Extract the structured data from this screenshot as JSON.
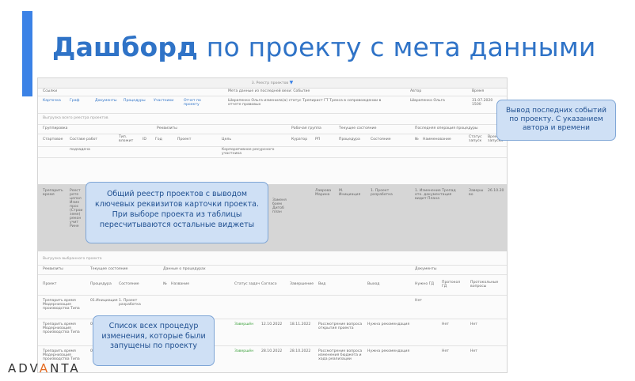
{
  "slide": {
    "title_bold": "Дашборд",
    "title_rest": " по проекту с мета данными"
  },
  "screen": {
    "header": "3. Реестр проектов",
    "row1": {
      "labels": [
        "Ссылки",
        "Мета данные из последней вехи: Событие",
        "Автор",
        "Время"
      ],
      "links": [
        "Карточка",
        "Граф",
        "Документы",
        "Процедуры",
        "Участники",
        "Отчет по проекту"
      ],
      "event": "Шарапенко Ольга изменила(а) статус Трепирист ГТ Трекса в сопровождении в отчете правовых",
      "author": "Шарапенко Ольга",
      "time": "31.07.2020 1500"
    },
    "section1": "Выгрузка всего реестра проектов",
    "row2": [
      "Группировка",
      "Реквизиты",
      "Рабочая группа",
      "Текущее состояние",
      "Последняя операция процедуры"
    ],
    "row3": [
      "Стартовое",
      "Составе работ",
      "Тип. вложит",
      "ID",
      "Год",
      "Проект",
      "Цель",
      "Куратор",
      "РП",
      "Процедура",
      "Состояние",
      "№",
      "Наименование",
      "Статус запуск",
      "Время запуска"
    ],
    "row4": [
      "подзадача",
      "Корпоративное ресурсного участника"
    ],
    "gray": {
      "c1": "Трепарить время",
      "c2": "Реест рете цепол Изме прос (Строи земе) рекон учит Рине",
      "c3": "Заменя боем Дитоб план",
      "c4": "Лаврова Марина",
      "c5": "М. Инициация",
      "c6": "1. Проект разработка",
      "c7": "1. Изменение Трепад отк. документация видит Плана",
      "c8": "Заверш во",
      "c9": "26.10.20"
    },
    "section2": "Выгрузка выбранного проекта",
    "row5": [
      "Реквизиты",
      "Текущее состояние",
      "Данные о процедурах",
      "Документы"
    ],
    "row6": [
      "Проект",
      "Процедура",
      "Состояние",
      "№",
      "Название",
      "Статус задач",
      "Согласо",
      "Завершение",
      "Вид",
      "Выход",
      "Нужно ГД",
      "Протокол ГД",
      "Протокольные вопросы"
    ],
    "rows": [
      {
        "c1": "Трепарить время Модернизация производства Типа",
        "c2": "01.Инициация",
        "c3": "1. Проект разработка",
        "c4": "",
        "c5": "",
        "c6": "",
        "c7": "",
        "c8": "",
        "c9": "",
        "c10": "Нет",
        "c11": "",
        "c12": ""
      },
      {
        "c1": "Трепарить время Модернизация производства Типа",
        "c2": "01",
        "c3": "",
        "c4": "",
        "c5": "",
        "c6": "Завершён",
        "c7": "12.10.2022",
        "c8": "18.11.2022",
        "c9": "Рассмотрение вопроса открытия проекта",
        "c10": "Нужна рекомендация",
        "c11": "Нет",
        "c12": "Нет"
      },
      {
        "c1": "Трепарить время Модернизация производства Типа",
        "c2": "01",
        "c3": "",
        "c4": "",
        "c5": "",
        "c6": "Завершён",
        "c7": "28.10.2022",
        "c8": "28.10.2022",
        "c9": "Рассмотрение вопроса изменения бюджета и хода реализации",
        "c10": "Нужна рекомендация",
        "c11": "Нет",
        "c12": "Нет"
      }
    ]
  },
  "callouts": {
    "events": "Вывод последних событий по проекту. С указанием автора и времени",
    "registry": "Общий реестр проектов с выводом ключевых реквизитов карточки проекта. При выборе проекта из таблицы пересчитываются остальные виджеты",
    "procedures": "Список всех процедур изменения, которые были запущены по проекту"
  },
  "logo": {
    "p1": "ADV",
    "p2": "A",
    "p3": "NTA"
  },
  "colors": {
    "accent": "#3b82e6",
    "title": "#2f73c7",
    "callout_bg": "#cfe0f5",
    "logo_accent": "#e56a1f"
  }
}
